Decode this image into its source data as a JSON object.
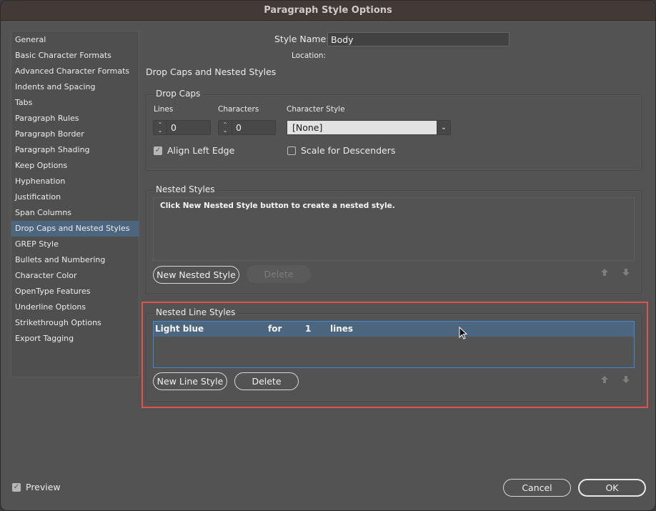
{
  "window": {
    "title": "Paragraph Style Options"
  },
  "sidebar": {
    "items": [
      {
        "label": "General"
      },
      {
        "label": "Basic Character Formats"
      },
      {
        "label": "Advanced Character Formats"
      },
      {
        "label": "Indents and Spacing"
      },
      {
        "label": "Tabs"
      },
      {
        "label": "Paragraph Rules"
      },
      {
        "label": "Paragraph Border"
      },
      {
        "label": "Paragraph Shading"
      },
      {
        "label": "Keep Options"
      },
      {
        "label": "Hyphenation"
      },
      {
        "label": "Justification"
      },
      {
        "label": "Span Columns"
      },
      {
        "label": "Drop Caps and Nested Styles",
        "selected": true
      },
      {
        "label": "GREP Style"
      },
      {
        "label": "Bullets and Numbering"
      },
      {
        "label": "Character Color"
      },
      {
        "label": "OpenType Features"
      },
      {
        "label": "Underline Options"
      },
      {
        "label": "Strikethrough Options"
      },
      {
        "label": "Export Tagging"
      }
    ]
  },
  "header": {
    "style_name_label": "Style Name:",
    "style_name_value": "Body",
    "location_label": "Location:",
    "section_title": "Drop Caps and Nested Styles"
  },
  "drop_caps": {
    "title": "Drop Caps",
    "lines_label": "Lines",
    "lines_value": "0",
    "characters_label": "Characters",
    "characters_value": "0",
    "character_style_label": "Character Style",
    "character_style_value": "[None]",
    "align_left_edge_label": "Align Left Edge",
    "align_left_edge_checked": true,
    "scale_descenders_label": "Scale for Descenders",
    "scale_descenders_checked": false
  },
  "nested_styles": {
    "title": "Nested Styles",
    "empty_hint": "Click New Nested Style button to create a nested style.",
    "new_button": "New Nested Style",
    "delete_button": "Delete"
  },
  "nested_line_styles": {
    "title": "Nested Line Styles",
    "rows": [
      {
        "style": "Light blue",
        "for": "for",
        "count": "1",
        "unit": "lines"
      }
    ],
    "new_button": "New Line Style",
    "delete_button": "Delete"
  },
  "icons": {
    "move_up": "arrow-up-icon",
    "move_down": "arrow-down-icon",
    "stepper": "stepper-icon",
    "dropdown": "chevron-down-icon",
    "checkmark": "checkmark-icon",
    "pointer": "mouse-pointer-icon"
  },
  "colors": {
    "selection": "#4c6680",
    "focus_border": "#3f8ad4",
    "annotation_highlight": "#e0544c"
  },
  "footer": {
    "preview_label": "Preview",
    "preview_checked": true,
    "cancel_button": "Cancel",
    "ok_button": "OK"
  }
}
